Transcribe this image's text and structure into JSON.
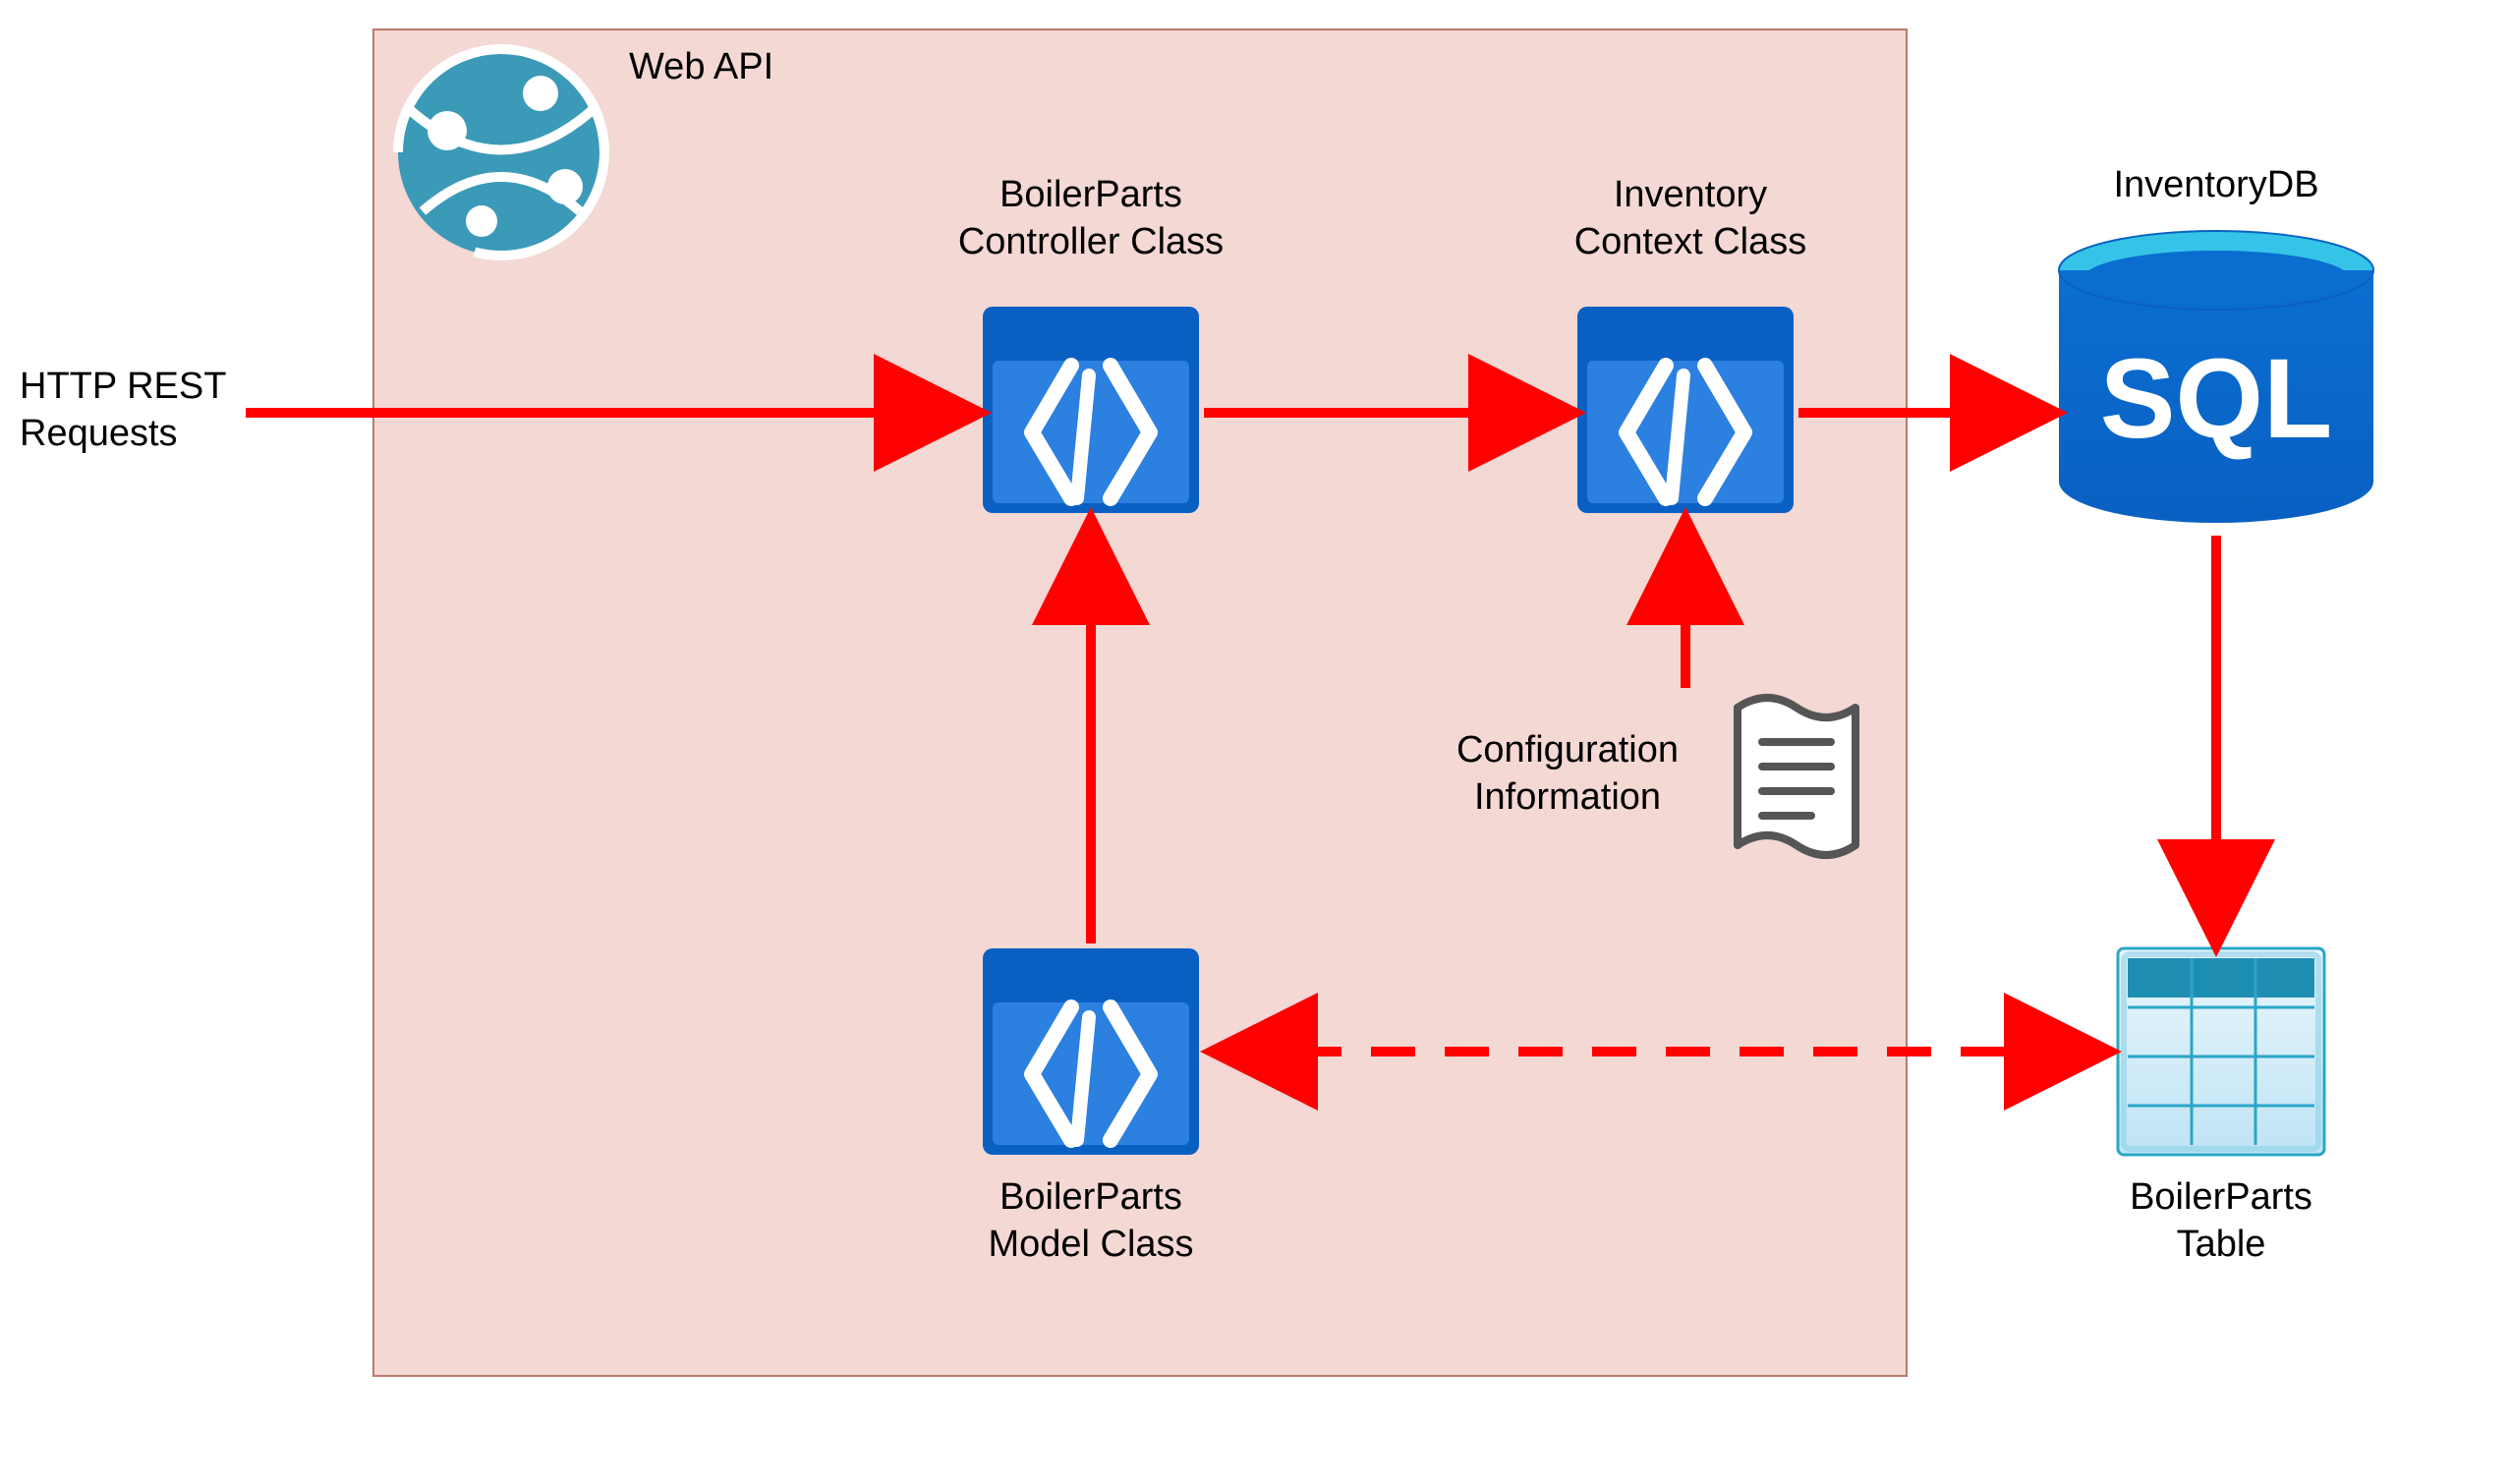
{
  "container": {
    "title": "Web API"
  },
  "external": {
    "request_label": "HTTP REST\nRequests",
    "db_label": "InventoryDB",
    "table_label": "BoilerParts\nTable"
  },
  "nodes": {
    "controller_label": "BoilerParts\nController Class",
    "context_label": "Inventory\nContext Class",
    "model_label": "BoilerParts\nModel Class",
    "config_label": "Configuration\nInformation"
  },
  "icons": {
    "code": "code-icon",
    "sql_text": "SQL"
  }
}
